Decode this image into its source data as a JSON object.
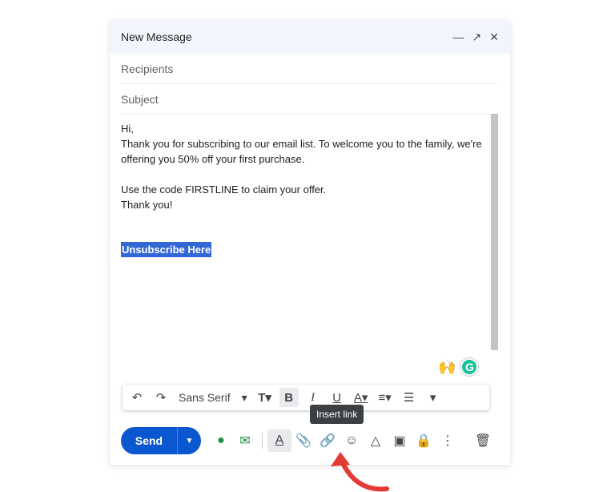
{
  "header": {
    "title": "New Message"
  },
  "fields": {
    "recipients": "Recipients",
    "subject": "Subject"
  },
  "body": {
    "greeting": "Hi,",
    "line1": "Thank you for subscribing to our email list. To welcome you to the family, we're",
    "line2": "offering you 50% off your first purchase.",
    "line3": "Use the code FIRSTLINE to claim your offer.",
    "line4": "Thank you!",
    "link": "Unsubscribe Here"
  },
  "format_bar": {
    "font": "Sans Serif"
  },
  "tooltip": "Insert link",
  "bottom": {
    "send_label": "Send"
  },
  "colors": {
    "send": "#0b57d0",
    "selection": "#3367d6",
    "arrow": "#e53935"
  }
}
